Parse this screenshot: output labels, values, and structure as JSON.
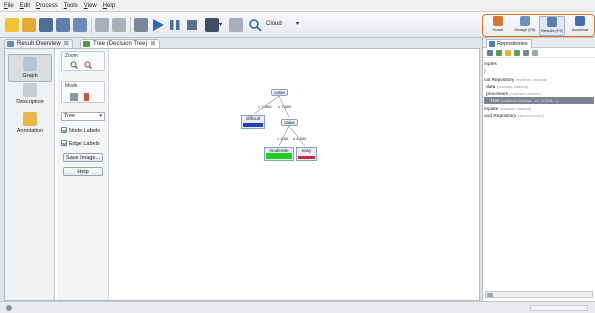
{
  "menu": [
    {
      "u": "F",
      "rest": "ile"
    },
    {
      "u": "E",
      "rest": "dit"
    },
    {
      "u": "P",
      "rest": "rocess"
    },
    {
      "u": "T",
      "rest": "ools"
    },
    {
      "u": "V",
      "rest": "iew"
    },
    {
      "u": "H",
      "rest": "elp"
    }
  ],
  "toolbar": {
    "connection_label": "Cloud",
    "connection_caret": "▾"
  },
  "perspectives": [
    {
      "label": "Home"
    },
    {
      "label": "Design (F8)"
    },
    {
      "label": "Results (F9)"
    },
    {
      "label": "Accelerat"
    }
  ],
  "tabs": [
    {
      "label": "Result Overview",
      "close": "⊠"
    },
    {
      "label": "Tree (Decision Tree)",
      "close": "⊠"
    }
  ],
  "views": [
    {
      "label": "Graph"
    },
    {
      "label": "Description"
    },
    {
      "label": "Annotation"
    }
  ],
  "controls": {
    "zoom_title": "Zoom",
    "mode_title": "Mode",
    "layout_select": "Tree",
    "layout_arrow": "▾",
    "node_labels": "Node Labels",
    "edge_labels": "Edge Labels",
    "save_image": "Save Image...",
    "help": "Help"
  },
  "tree": {
    "root": "value",
    "root_left_edge": "> 7.500",
    "root_right_edge": "≤ 7.500",
    "leaf_difficult": "difficult",
    "child": "value",
    "child_left_edge": "> 4.50",
    "child_right_edge": "≤ 4.500",
    "leaf_moderate": "moderate",
    "leaf_easy": "easy"
  },
  "repository": {
    "tab_label": "Repositories",
    "rows": [
      {
        "text": "mples",
        "muted": ""
      },
      {
        "text": ")",
        "muted": ""
      },
      {
        "text": "cal Repository",
        "muted": "(madhav-Vaasha)"
      },
      {
        "text": "data",
        "muted": "(madhav-Vaasha)"
      },
      {
        "text": "processes",
        "muted": "(madhav-Vaasha)"
      },
      {
        "text": "Tree",
        "muted": "(madhav-Vaasha - v1, 5/3/18 ...)"
      },
      {
        "text": "mplate",
        "muted": "(madhav-Vaasha)"
      },
      {
        "text": "oud Repository",
        "muted": "(disconnected)"
      }
    ]
  },
  "colors": {
    "leaf_difficult": "#1e3fbf",
    "leaf_moderate": "#1fcf1f",
    "leaf_easy": "#c8283a",
    "perspective_border": "#d9732e"
  }
}
